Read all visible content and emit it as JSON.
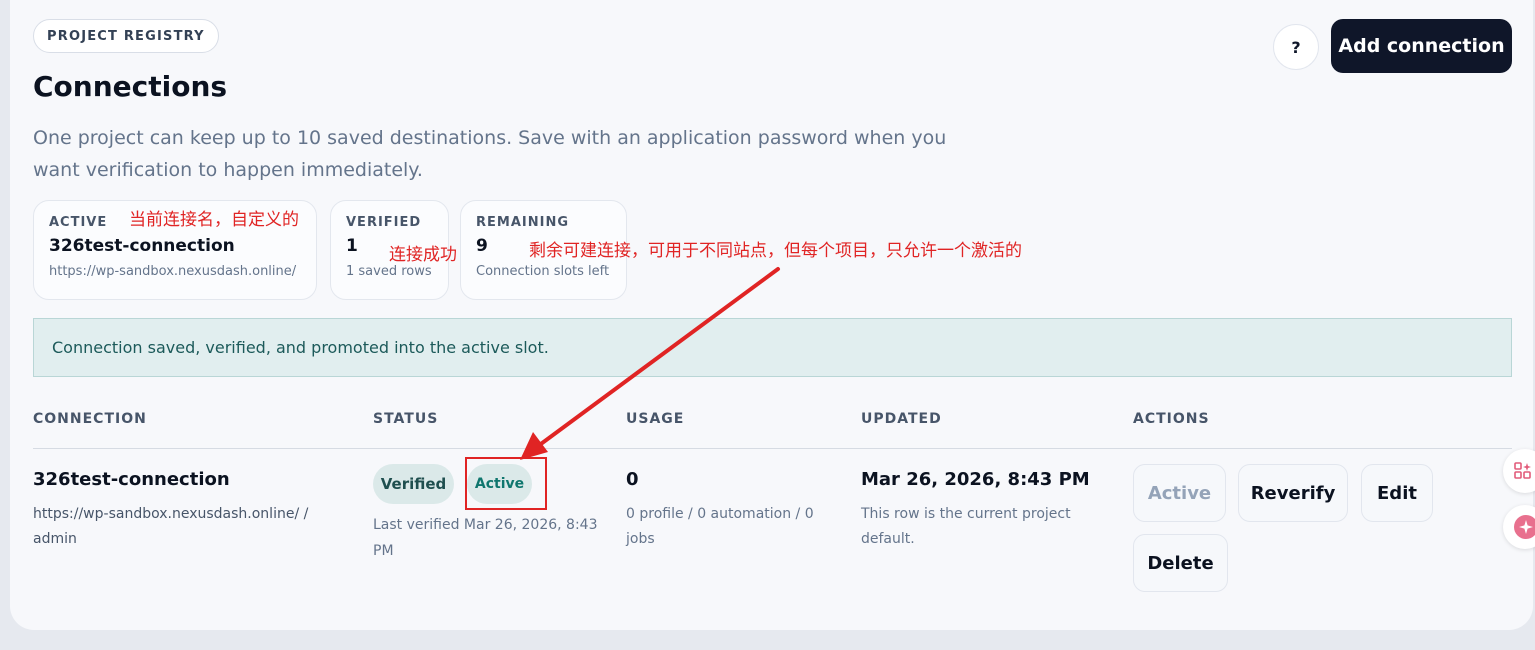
{
  "header": {
    "tag": "PROJECT REGISTRY",
    "title": "Connections",
    "description": "One project can keep up to 10 saved destinations. Save with an application password when you want verification to happen immediately.",
    "help_label": "?",
    "add_button": "Add connection"
  },
  "stats": [
    {
      "label": "ACTIVE",
      "value": "326test-connection",
      "sub": "https://wp-sandbox.nexusdash.online/"
    },
    {
      "label": "VERIFIED",
      "value": "1",
      "sub": "1 saved rows"
    },
    {
      "label": "REMAINING",
      "value": "9",
      "sub": "Connection slots left"
    }
  ],
  "banner": "Connection saved, verified, and promoted into the active slot.",
  "table": {
    "headers": [
      "CONNECTION",
      "STATUS",
      "USAGE",
      "UPDATED",
      "ACTIONS"
    ],
    "rows": [
      {
        "name": "326test-connection",
        "url": "https://wp-sandbox.nexusdash.online/ / admin",
        "badges": [
          "Verified",
          "Active"
        ],
        "last_verified": "Last verified Mar 26, 2026, 8:43 PM",
        "usage_count": "0",
        "usage_detail": "0 profile / 0 automation / 0 jobs",
        "updated": "Mar 26, 2026, 8:43 PM",
        "updated_note": "This row is the current project default.",
        "actions": [
          "Active",
          "Reverify",
          "Edit",
          "Delete"
        ]
      }
    ]
  },
  "annotations": {
    "active_note": "当前连接名，自定义的",
    "verified_note": "连接成功",
    "remaining_note": "剩余可建连接，可用于不同站点，但每个项目，只允许一个激活的"
  },
  "colors": {
    "accent_dark": "#0f1629",
    "annotation_red": "#e02424",
    "banner_bg": "#e1eeef",
    "badge_bg": "#dbe9e9"
  }
}
